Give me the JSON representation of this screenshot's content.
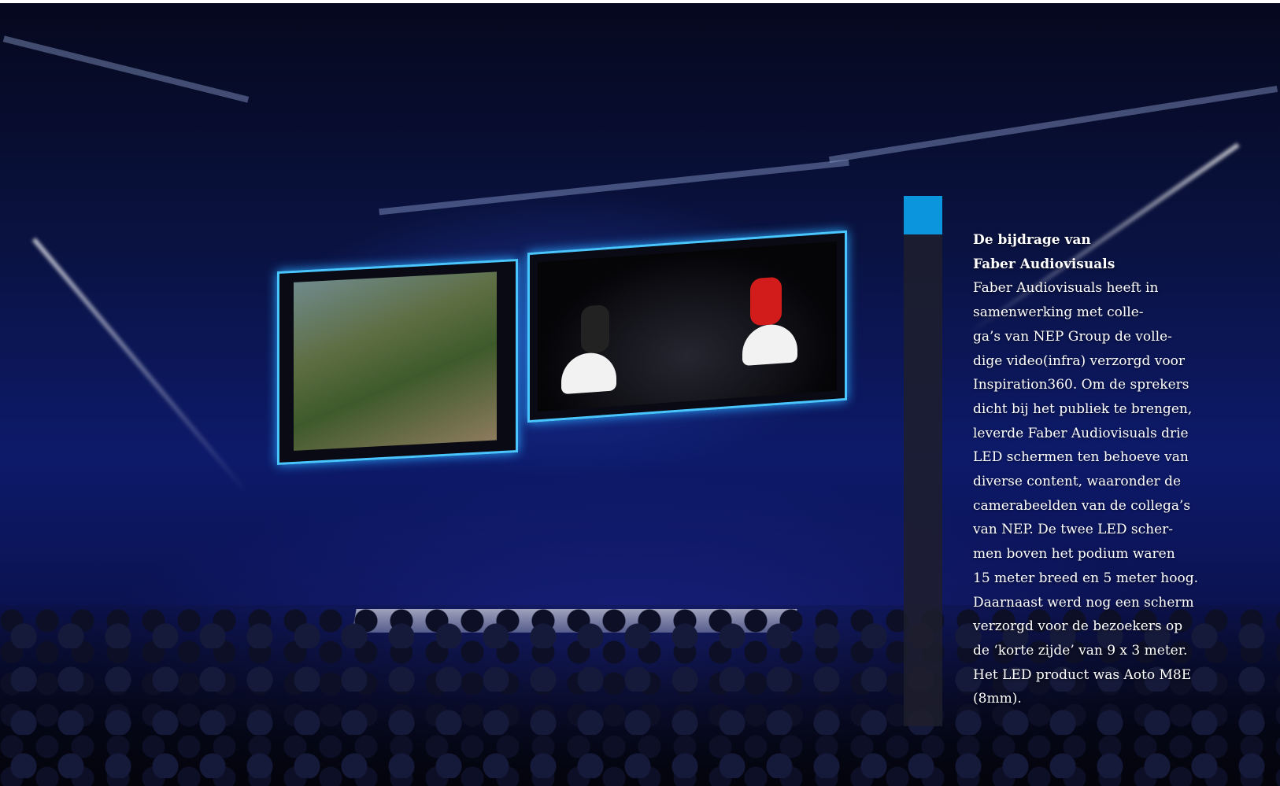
{
  "panel": {
    "title_lines": [
      "De bijdrage van",
      "Faber Audiovisuals"
    ],
    "body_lines": [
      "Faber Audiovisuals heeft in",
      "samenwerking met colle-",
      "ga’s van NEP Group de volle-",
      "dige video(infra) verzorgd voor",
      "Inspiration360. Om de sprekers",
      "dicht bij het publiek te brengen,",
      "leverde Faber Audiovisuals drie",
      "LED schermen ten behoeve van",
      "diverse content, waaronder de",
      "camerabeelden van de collega’s",
      "van NEP. De twee LED scher-",
      "men boven het podium waren",
      "15 meter breed en 5 meter hoog.",
      "Daarnaast werd nog een scherm",
      "verzorgd voor de bezoekers op",
      "de ‘korte zijde’ van 9 x 3 meter.",
      "Het LED product was Aoto M8E",
      "(8mm)."
    ]
  },
  "colors": {
    "accent": "#0a95dc",
    "panel_bar": "#1e1e2d",
    "screen_border": "#49c6ff"
  }
}
